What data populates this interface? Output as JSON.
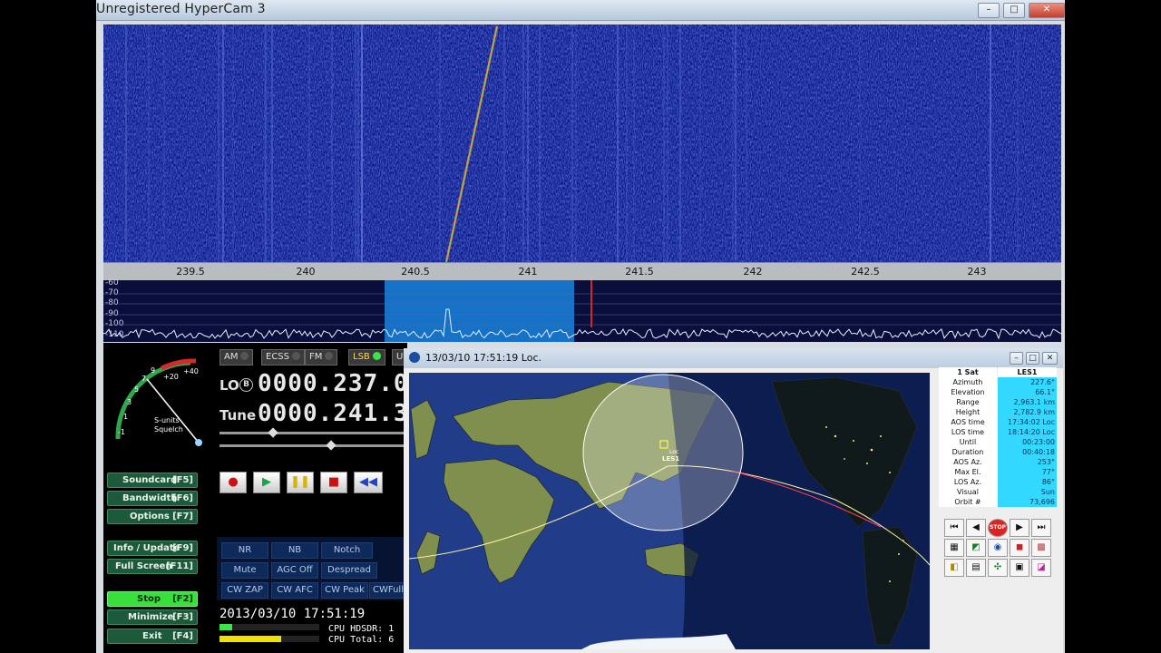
{
  "window": {
    "title": "Unregistered HyperCam 3",
    "controls": {
      "minimize": "–",
      "maximize": "□",
      "close": "✕"
    }
  },
  "waterfall": {
    "freq_ticks": [
      "239.5",
      "240",
      "240.5",
      "241",
      "241.5",
      "242",
      "242.5",
      "243"
    ],
    "db_labels": [
      "-60",
      "-70",
      "-80",
      "-90",
      "-100",
      "-110"
    ]
  },
  "smeter": {
    "scale_labels": [
      "-1",
      "1",
      "3",
      "5",
      "7",
      "9",
      "+20",
      "+40"
    ],
    "unit_label": "S-units",
    "squelch_label": "Squelch"
  },
  "modes": {
    "am": "AM",
    "ecss": "ECSS",
    "fm": "FM",
    "lsb": "LSB",
    "usb": "US"
  },
  "frequency": {
    "lo_label": "LO",
    "lo_badge": "B",
    "lo_value": "0000.237.0",
    "tune_label": "Tune",
    "tune_value": "0000.241.3"
  },
  "buttons": {
    "soundcard": {
      "label": "Soundcard",
      "key": "[F5]"
    },
    "bandwidth": {
      "label": "Bandwidth",
      "key": "[F6]"
    },
    "options": {
      "label": "Options",
      "key": "[F7]"
    },
    "info": {
      "label": "Info / Update",
      "key": "[F9]"
    },
    "fullscreen": {
      "label": "Full Screen",
      "key": "[F11]"
    },
    "stop": {
      "label": "Stop",
      "key": "[F2]"
    },
    "minimize": {
      "label": "Minimize",
      "key": "[F3]"
    },
    "exit": {
      "label": "Exit",
      "key": "[F4]"
    }
  },
  "functions": {
    "nr": "NR",
    "nb": "NB",
    "notch": "Notch",
    "mute": "Mute",
    "agc": "AGC Off",
    "despread": "Despread",
    "cwzap": "CW ZAP",
    "cwafc": "CW AFC",
    "cwpeak": "CW Peak",
    "cwfull": "CWFull"
  },
  "status": {
    "datetime": "2013/03/10 17:51:19",
    "cpu_hdsdr": "CPU HDSDR: 1",
    "cpu_total": "CPU Total: 6"
  },
  "orbitron": {
    "title": "13/03/10  17:51:19 Loc.",
    "sat_label": "LES1",
    "location_label": "Loc",
    "info_header": {
      "key": "1 Sat",
      "value": "LES1"
    },
    "info_rows": [
      {
        "key": "Azimuth",
        "value": "227.6°"
      },
      {
        "key": "Elevation",
        "value": "66.1°"
      },
      {
        "key": "Range",
        "value": "2,963.1 km"
      },
      {
        "key": "Height",
        "value": "2,782.9 km"
      },
      {
        "key": "AOS time",
        "value": "17:34:02 Loc"
      },
      {
        "key": "LOS time",
        "value": "18:14:20 Loc"
      },
      {
        "key": "Until",
        "value": "00:23:00"
      },
      {
        "key": "Duration",
        "value": "00:40:18"
      },
      {
        "key": "AOS Az.",
        "value": "253°"
      },
      {
        "key": "Max El.",
        "value": "77°"
      },
      {
        "key": "LOS Az.",
        "value": "86°"
      },
      {
        "key": "Visual",
        "value": "Sun"
      },
      {
        "key": "Orbit #",
        "value": "73,696"
      }
    ],
    "stop_label": "STOP"
  }
}
